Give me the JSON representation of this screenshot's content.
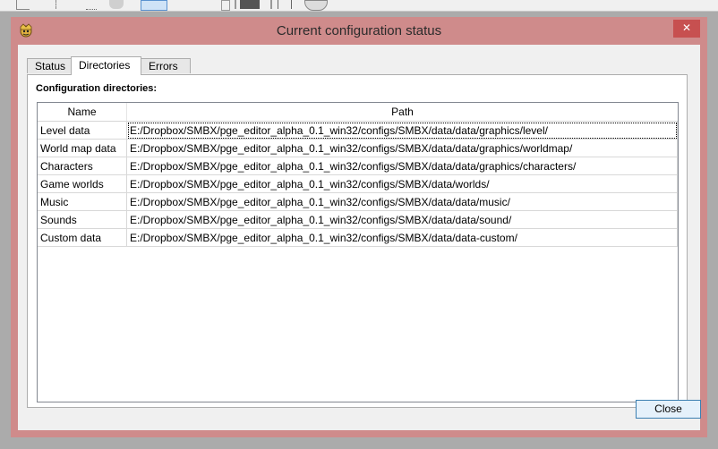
{
  "window": {
    "title": "Current configuration status",
    "close_glyph": "✕"
  },
  "tabs": [
    {
      "label": "Status"
    },
    {
      "label": "Directories"
    },
    {
      "label": "Errors"
    }
  ],
  "directories": {
    "section_label": "Configuration directories:",
    "columns": [
      "Name",
      "Path"
    ],
    "rows": [
      {
        "name": "Level data",
        "path": "E:/Dropbox/SMBX/pge_editor_alpha_0.1_win32/configs/SMBX/data/data/graphics/level/"
      },
      {
        "name": "World map data",
        "path": "E:/Dropbox/SMBX/pge_editor_alpha_0.1_win32/configs/SMBX/data/data/graphics/worldmap/"
      },
      {
        "name": "Characters",
        "path": "E:/Dropbox/SMBX/pge_editor_alpha_0.1_win32/configs/SMBX/data/data/graphics/characters/"
      },
      {
        "name": "Game worlds",
        "path": "E:/Dropbox/SMBX/pge_editor_alpha_0.1_win32/configs/SMBX/data/worlds/"
      },
      {
        "name": "Music",
        "path": "E:/Dropbox/SMBX/pge_editor_alpha_0.1_win32/configs/SMBX/data/data/music/"
      },
      {
        "name": "Sounds",
        "path": "E:/Dropbox/SMBX/pge_editor_alpha_0.1_win32/configs/SMBX/data/data/sound/"
      },
      {
        "name": "Custom data",
        "path": "E:/Dropbox/SMBX/pge_editor_alpha_0.1_win32/configs/SMBX/data/data-custom/"
      }
    ]
  },
  "buttons": {
    "close_label": "Close"
  },
  "colors": {
    "title_bar": "#cf8b8b",
    "close_button_bg": "#c75050",
    "default_button_border": "#3c7fb1"
  }
}
